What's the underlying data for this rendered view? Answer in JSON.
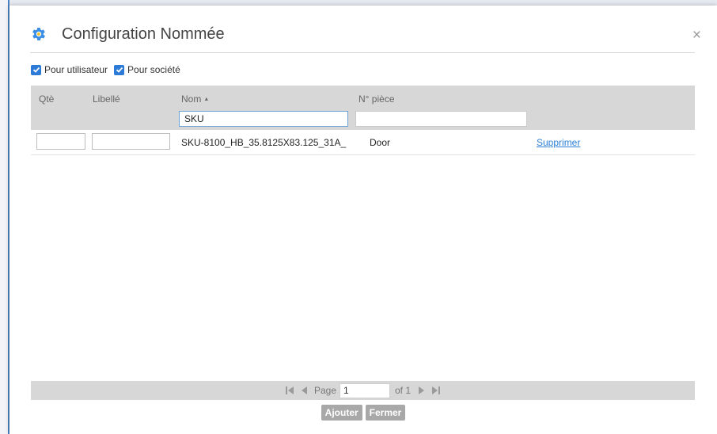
{
  "dialog": {
    "title": "Configuration Nommée",
    "close_label": "×"
  },
  "filters": {
    "user": {
      "label": "Pour utilisateur",
      "checked": true
    },
    "company": {
      "label": "Pour société",
      "checked": true
    }
  },
  "grid": {
    "columns": {
      "qty": "Qtè",
      "label": "Libellé",
      "name": "Nom",
      "part": "N° pièce"
    },
    "name_sort": "ascending",
    "filter_name_value": "SKU",
    "filter_part_value": "",
    "rows": [
      {
        "qty": "",
        "label": "",
        "name": "SKU-8100_HB_35.8125X83.125_31A_",
        "part": "Door",
        "action": "Supprimer"
      }
    ]
  },
  "pager": {
    "page_label": "Page",
    "page_value": "1",
    "of_label": "of 1"
  },
  "buttons": {
    "add": "Ajouter",
    "close": "Fermer"
  },
  "colors": {
    "accent": "#2d7bd6",
    "header_bg": "#d7d7d7",
    "link": "#2b7fd4"
  }
}
